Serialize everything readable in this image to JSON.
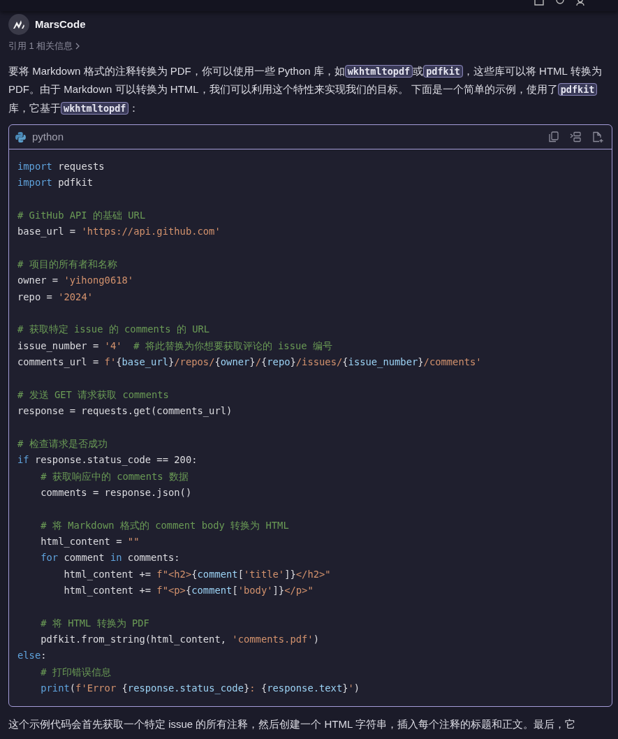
{
  "assistant": {
    "name": "MarsCode"
  },
  "references": {
    "label": "引用 1 相关信息"
  },
  "intro": [
    {
      "kind": "text",
      "text": "要将 Markdown 格式的注释转换为 PDF，你可以使用一些 Python 库，如"
    },
    {
      "kind": "code",
      "text": "wkhtmltopdf"
    },
    {
      "kind": "text",
      "text": "或"
    },
    {
      "kind": "code",
      "text": "pdfkit"
    },
    {
      "kind": "text",
      "text": "，这些库可以将 HTML 转换为 PDF。由于 Markdown 可以转换为 HTML，我们可以利用这个特性来实现我们的目标。 下面是一个简单的示例，使用了"
    },
    {
      "kind": "code",
      "text": "pdfkit"
    },
    {
      "kind": "text",
      "text": "库，它基于"
    },
    {
      "kind": "code",
      "text": "wkhtmltopdf"
    },
    {
      "kind": "text",
      "text": "："
    }
  ],
  "code_block": {
    "language": "python",
    "blocks": [
      [
        [
          {
            "kind": "kw",
            "text": "import"
          },
          {
            "kind": "txt",
            "text": " requests"
          }
        ],
        [
          {
            "kind": "kw",
            "text": "import"
          },
          {
            "kind": "txt",
            "text": " pdfkit"
          }
        ]
      ],
      [
        [
          {
            "kind": "com",
            "text": "# GitHub API 的基础 URL"
          }
        ],
        [
          {
            "kind": "txt",
            "text": "base_url = "
          },
          {
            "kind": "str",
            "text": "'https://api.github.com'"
          }
        ]
      ],
      [
        [
          {
            "kind": "com",
            "text": "# 项目的所有者和名称"
          }
        ],
        [
          {
            "kind": "txt",
            "text": "owner = "
          },
          {
            "kind": "str",
            "text": "'yihong0618'"
          }
        ],
        [
          {
            "kind": "txt",
            "text": "repo = "
          },
          {
            "kind": "str",
            "text": "'2024'"
          }
        ]
      ],
      [
        [
          {
            "kind": "com",
            "text": "# 获取特定 issue 的 comments 的 URL"
          }
        ],
        [
          {
            "kind": "txt",
            "text": "issue_number = "
          },
          {
            "kind": "str",
            "text": "'4'"
          },
          {
            "kind": "com",
            "text": "  # 将此替换为你想要获取评论的 issue 编号"
          }
        ],
        [
          {
            "kind": "txt",
            "text": "comments_url = "
          },
          {
            "kind": "str",
            "text": "f'"
          },
          {
            "kind": "txt",
            "text": "{"
          },
          {
            "kind": "var",
            "text": "base_url"
          },
          {
            "kind": "txt",
            "text": "}"
          },
          {
            "kind": "str",
            "text": "/repos/"
          },
          {
            "kind": "txt",
            "text": "{"
          },
          {
            "kind": "var",
            "text": "owner"
          },
          {
            "kind": "txt",
            "text": "}"
          },
          {
            "kind": "str",
            "text": "/"
          },
          {
            "kind": "txt",
            "text": "{"
          },
          {
            "kind": "var",
            "text": "repo"
          },
          {
            "kind": "txt",
            "text": "}"
          },
          {
            "kind": "str",
            "text": "/issues/"
          },
          {
            "kind": "txt",
            "text": "{"
          },
          {
            "kind": "var",
            "text": "issue_number"
          },
          {
            "kind": "txt",
            "text": "}"
          },
          {
            "kind": "str",
            "text": "/comments'"
          }
        ]
      ],
      [
        [
          {
            "kind": "com",
            "text": "# 发送 GET 请求获取 comments"
          }
        ],
        [
          {
            "kind": "txt",
            "text": "response = requests.get(comments_url)"
          }
        ]
      ],
      [
        [
          {
            "kind": "com",
            "text": "# 检查请求是否成功"
          }
        ],
        [
          {
            "kind": "kw",
            "text": "if"
          },
          {
            "kind": "txt",
            "text": " response.status_code == 200:"
          }
        ],
        [
          {
            "kind": "com",
            "text": "    # 获取响应中的 comments 数据"
          }
        ],
        [
          {
            "kind": "txt",
            "text": "    comments = response.json()"
          }
        ]
      ],
      [
        [
          {
            "kind": "com",
            "text": "    # 将 Markdown 格式的 comment body 转换为 HTML"
          }
        ],
        [
          {
            "kind": "txt",
            "text": "    html_content = "
          },
          {
            "kind": "str",
            "text": "\"\""
          }
        ],
        [
          {
            "kind": "kw",
            "text": "    for"
          },
          {
            "kind": "txt",
            "text": " comment "
          },
          {
            "kind": "kw",
            "text": "in"
          },
          {
            "kind": "txt",
            "text": " comments:"
          }
        ],
        [
          {
            "kind": "txt",
            "text": "        html_content += "
          },
          {
            "kind": "str",
            "text": "f\"<h2>"
          },
          {
            "kind": "txt",
            "text": "{"
          },
          {
            "kind": "var",
            "text": "comment"
          },
          {
            "kind": "txt",
            "text": "["
          },
          {
            "kind": "str",
            "text": "'title'"
          },
          {
            "kind": "txt",
            "text": "]}"
          },
          {
            "kind": "str",
            "text": "</h2>\""
          }
        ],
        [
          {
            "kind": "txt",
            "text": "        html_content += "
          },
          {
            "kind": "str",
            "text": "f\"<p>"
          },
          {
            "kind": "txt",
            "text": "{"
          },
          {
            "kind": "var",
            "text": "comment"
          },
          {
            "kind": "txt",
            "text": "["
          },
          {
            "kind": "str",
            "text": "'body'"
          },
          {
            "kind": "txt",
            "text": "]}"
          },
          {
            "kind": "str",
            "text": "</p>\""
          }
        ]
      ],
      [
        [
          {
            "kind": "com",
            "text": "    # 将 HTML 转换为 PDF"
          }
        ],
        [
          {
            "kind": "txt",
            "text": "    pdfkit.from_string(html_content, "
          },
          {
            "kind": "str",
            "text": "'comments.pdf'"
          },
          {
            "kind": "txt",
            "text": ")"
          }
        ],
        [
          {
            "kind": "kw",
            "text": "else"
          },
          {
            "kind": "txt",
            "text": ":"
          }
        ],
        [
          {
            "kind": "com",
            "text": "    # 打印错误信息"
          }
        ],
        [
          {
            "kind": "kw",
            "text": "    print"
          },
          {
            "kind": "txt",
            "text": "("
          },
          {
            "kind": "str",
            "text": "f'Error "
          },
          {
            "kind": "txt",
            "text": "{"
          },
          {
            "kind": "var",
            "text": "response.status_code"
          },
          {
            "kind": "txt",
            "text": "}"
          },
          {
            "kind": "str",
            "text": ": "
          },
          {
            "kind": "txt",
            "text": "{"
          },
          {
            "kind": "var",
            "text": "response.text"
          },
          {
            "kind": "txt",
            "text": "}"
          },
          {
            "kind": "str",
            "text": "'"
          },
          {
            "kind": "txt",
            "text": ")"
          }
        ]
      ]
    ]
  },
  "outro": [
    {
      "kind": "text",
      "text": "这个示例代码会首先获取一个特定 issue 的所有注释，然后创建一个 HTML 字符串，插入每个注释的标题和正文。最后，它"
    }
  ]
}
